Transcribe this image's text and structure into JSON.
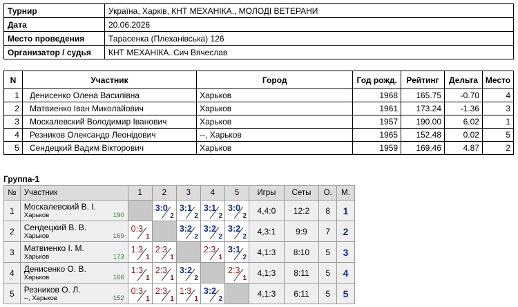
{
  "info": [
    {
      "key": "Турнир",
      "value": "Україна, Харків, КНТ МЕХАНІКА., МОЛОДІ ВЕТЕРАНИ"
    },
    {
      "key": "Дата",
      "value": "20.06.2026"
    },
    {
      "key": "Место проведения",
      "value": "Тарасенка (Плеханівська) 126"
    },
    {
      "key": "Организатор / судья",
      "value": "КНТ МЕХАНІКА. Сич Вячеслав"
    }
  ],
  "participants": {
    "headers": [
      "N",
      "Участник",
      "Город",
      "Год рожд.",
      "Рейтинг",
      "Дельта",
      "Место"
    ],
    "rows": [
      {
        "n": "1",
        "name": "Денисенко Олена Василівна",
        "city": "Харьков",
        "year": "1968",
        "rating": "165.75",
        "delta": "-0.70",
        "place": "4"
      },
      {
        "n": "2",
        "name": "Матвиенко Іван Миколайович",
        "city": "Харьков",
        "year": "1961",
        "rating": "173.24",
        "delta": "-1.36",
        "place": "3"
      },
      {
        "n": "3",
        "name": "Москалевский Володимир Іванович",
        "city": "Харьков",
        "year": "1957",
        "rating": "190.00",
        "delta": "6.02",
        "place": "1"
      },
      {
        "n": "4",
        "name": "Резников Олександр Леонідович",
        "city": "--, Харьков",
        "year": "1965",
        "rating": "152.48",
        "delta": "0.02",
        "place": "5"
      },
      {
        "n": "5",
        "name": "Сендецкий Вадим Вікторович",
        "city": "Харьков",
        "year": "1959",
        "rating": "169.46",
        "delta": "4.87",
        "place": "2"
      }
    ]
  },
  "group": {
    "title": "Группа-1",
    "headers": {
      "num": "№",
      "player": "Участник",
      "cols": [
        "1",
        "2",
        "3",
        "4",
        "5"
      ],
      "games": "Игры",
      "sets": "Сеты",
      "points": "О.",
      "place": "М."
    },
    "rows": [
      {
        "num": "1",
        "name": "Москалевский В. І.",
        "city": "Харьков",
        "rating": "190",
        "cells": [
          null,
          {
            "score": "3:0",
            "g": "2",
            "win": true
          },
          {
            "score": "3:1",
            "g": "2",
            "win": true
          },
          {
            "score": "3:1",
            "g": "2",
            "win": true
          },
          {
            "score": "3:0",
            "g": "2",
            "win": true
          }
        ],
        "games": "4,4:0",
        "sets": "12:2",
        "points": "8",
        "place": "1"
      },
      {
        "num": "2",
        "name": "Сендецкий В. В.",
        "city": "Харьков",
        "rating": "169",
        "cells": [
          {
            "score": "0:3",
            "g": "1",
            "win": false
          },
          null,
          {
            "score": "3:2",
            "g": "2",
            "win": true
          },
          {
            "score": "3:2",
            "g": "2",
            "win": true
          },
          {
            "score": "3:2",
            "g": "2",
            "win": true
          }
        ],
        "games": "4,3:1",
        "sets": "9:9",
        "points": "7",
        "place": "2"
      },
      {
        "num": "3",
        "name": "Матвиенко І. М.",
        "city": "Харьков",
        "rating": "173",
        "cells": [
          {
            "score": "1:3",
            "g": "1",
            "win": false
          },
          {
            "score": "2:3",
            "g": "1",
            "win": false
          },
          null,
          {
            "score": "2:3",
            "g": "1",
            "win": false
          },
          {
            "score": "3:1",
            "g": "2",
            "win": true
          }
        ],
        "games": "4,1:3",
        "sets": "8:10",
        "points": "5",
        "place": "3"
      },
      {
        "num": "4",
        "name": "Денисенко О. В.",
        "city": "Харьков",
        "rating": "166",
        "cells": [
          {
            "score": "1:3",
            "g": "1",
            "win": false
          },
          {
            "score": "2:3",
            "g": "1",
            "win": false
          },
          {
            "score": "3:2",
            "g": "2",
            "win": true
          },
          null,
          {
            "score": "2:3",
            "g": "1",
            "win": false
          }
        ],
        "games": "4,1:3",
        "sets": "8:11",
        "points": "5",
        "place": "4"
      },
      {
        "num": "5",
        "name": "Резников О. Л.",
        "city": "--, Харьков",
        "rating": "152",
        "cells": [
          {
            "score": "0:3",
            "g": "1",
            "win": false
          },
          {
            "score": "2:3",
            "g": "1",
            "win": false
          },
          {
            "score": "1:3",
            "g": "1",
            "win": false
          },
          {
            "score": "3:2",
            "g": "2",
            "win": true
          },
          null
        ],
        "games": "4,1:3",
        "sets": "6:11",
        "points": "5",
        "place": "5"
      }
    ]
  }
}
